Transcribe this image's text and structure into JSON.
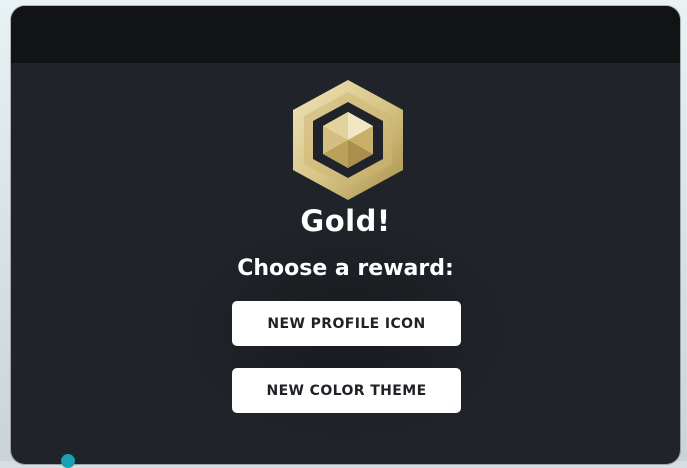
{
  "result": {
    "tier_icon": "gold-hexagon-badge-icon",
    "title": "Gold!",
    "prompt": "Choose a reward:"
  },
  "rewards": [
    {
      "label": "NEW PROFILE ICON"
    },
    {
      "label": "NEW COLOR THEME"
    }
  ],
  "colors": {
    "modal_background": "#20242a",
    "header_bar": "#121314",
    "gold_light": "#e6d9a8",
    "gold_dark": "#b49a55",
    "button_background": "#ffffff",
    "button_text": "#1e2126",
    "accent_dot": "#1a9fb3"
  }
}
